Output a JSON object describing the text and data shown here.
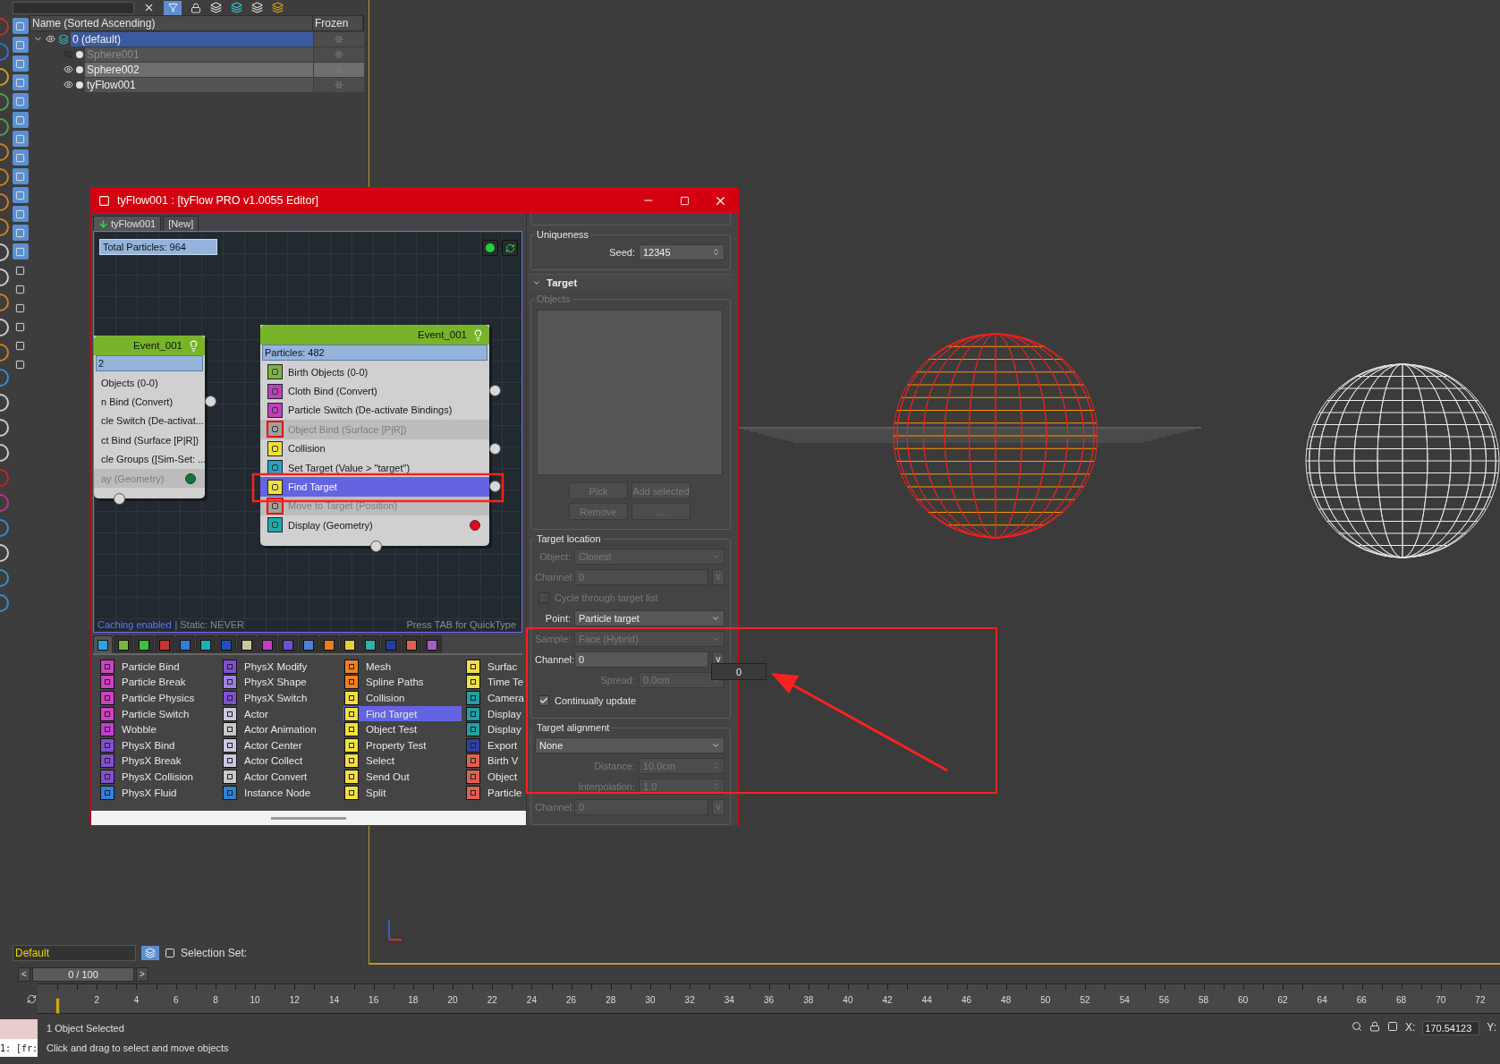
{
  "scene_explorer": {
    "columns": [
      "Name (Sorted Ascending)",
      "Frozen"
    ],
    "rows": [
      {
        "name": "0 (default)",
        "selected": true,
        "visible": true,
        "expanded": true,
        "children": [
          {
            "name": "Sphere001",
            "selected": false,
            "visible": false
          },
          {
            "name": "Sphere002",
            "selected": true,
            "visible": true
          },
          {
            "name": "tyFlow001",
            "selected": false,
            "visible": true
          }
        ]
      }
    ]
  },
  "editor": {
    "title": "tyFlow001 : [tyFlow PRO v1.0055 Editor]",
    "tabs": [
      {
        "label": "tyFlow001",
        "selected": true
      },
      {
        "label": "[New]",
        "selected": false
      }
    ],
    "total_particles": "Total Particles: 964",
    "nodes": [
      {
        "title": "Event_001",
        "particles": "2",
        "operators": [
          {
            "label": "Objects (0-0)",
            "enabled": true,
            "selected": false,
            "output": false
          },
          {
            "label": "n Bind (Convert)",
            "enabled": true,
            "selected": false,
            "output": true
          },
          {
            "label": "cle Switch (De-activat...",
            "enabled": true,
            "selected": false,
            "output": false
          },
          {
            "label": "ct Bind (Surface [P|R])",
            "enabled": true,
            "selected": false,
            "output": false
          },
          {
            "label": "cle Groups ([Sim-Set: ...",
            "enabled": true,
            "selected": false,
            "output": false
          },
          {
            "label": "ay (Geometry)",
            "enabled": false,
            "selected": false,
            "output": false,
            "status_dot": {
              "color": "#0a7a3a"
            }
          }
        ]
      },
      {
        "title": "Event_001",
        "particles": "Particles: 482",
        "operators": [
          {
            "label": "Birth Objects (0-0)",
            "enabled": true,
            "selected": false,
            "output": false,
            "color": "#7cb342"
          },
          {
            "label": "Cloth Bind (Convert)",
            "enabled": true,
            "selected": false,
            "output": true,
            "color": "#c040c0"
          },
          {
            "label": "Particle Switch (De-activate Bindings)",
            "enabled": true,
            "selected": false,
            "output": false,
            "color": "#c040c0"
          },
          {
            "label": "Object Bind (Surface [P|R])",
            "enabled": false,
            "selected": false,
            "output": false,
            "color": "#a0a0a0"
          },
          {
            "label": "Collision",
            "enabled": true,
            "selected": false,
            "output": true,
            "color": "#f0e040"
          },
          {
            "label": "Set Target (Value > \"target\")",
            "enabled": true,
            "selected": false,
            "output": false,
            "color": "#2aa0c8"
          },
          {
            "label": "Find Target",
            "enabled": true,
            "selected": true,
            "output": true,
            "color": "#f0e040"
          },
          {
            "label": "Move to Target (Position)",
            "enabled": false,
            "selected": false,
            "output": false,
            "color": "#a0a0a0"
          },
          {
            "label": "Display (Geometry)",
            "enabled": true,
            "selected": false,
            "output": false,
            "color": "#20a8a8",
            "status_dot": {
              "color": "#e8001c"
            }
          }
        ]
      }
    ],
    "footer": {
      "caching": "Caching enabled",
      "static": "| Static: NEVER",
      "hint": "Press TAB for QuickType"
    },
    "category_tabs": [
      {
        "color": "#30a0e0",
        "selected": true
      },
      {
        "color": "#7cb342",
        "selected": false
      },
      {
        "color": "#40c040",
        "selected": false
      },
      {
        "color": "#d03030",
        "selected": false
      },
      {
        "color": "#3080d0",
        "selected": false
      },
      {
        "color": "#20b0b0",
        "selected": false
      },
      {
        "color": "#2050c0",
        "selected": false
      },
      {
        "color": "#c8c8a0",
        "selected": false
      },
      {
        "color": "#c040c0",
        "selected": false
      },
      {
        "color": "#7050d0",
        "selected": false
      },
      {
        "color": "#5080d0",
        "selected": false
      },
      {
        "color": "#e08020",
        "selected": false
      },
      {
        "color": "#e0d040",
        "selected": false
      },
      {
        "color": "#30b0b0",
        "selected": false
      },
      {
        "color": "#2040a0",
        "selected": false
      },
      {
        "color": "#e06050",
        "selected": false
      },
      {
        "color": "#a060c0",
        "selected": false
      }
    ],
    "operator_columns": [
      [
        {
          "label": "Particle Bind",
          "color": "#d040c0",
          "selected": false
        },
        {
          "label": "Particle Break",
          "color": "#d040c0",
          "selected": false
        },
        {
          "label": "Particle Physics",
          "color": "#d040c0",
          "selected": false
        },
        {
          "label": "Particle Switch",
          "color": "#d040c0",
          "selected": false
        },
        {
          "label": "Wobble",
          "color": "#c040d0",
          "selected": false
        },
        {
          "label": "PhysX Bind",
          "color": "#8050d0",
          "selected": false
        },
        {
          "label": "PhysX Break",
          "color": "#8050d0",
          "selected": false
        },
        {
          "label": "PhysX Collision",
          "color": "#8050d0",
          "selected": false
        },
        {
          "label": "PhysX Fluid",
          "color": "#3080e0",
          "selected": false
        }
      ],
      [
        {
          "label": "PhysX Modify",
          "color": "#8050d0",
          "selected": false
        },
        {
          "label": "PhysX Shape",
          "color": "#a080e0",
          "selected": false
        },
        {
          "label": "PhysX Switch",
          "color": "#8050d0",
          "selected": false
        },
        {
          "label": "Actor",
          "color": "#c8c8e0",
          "selected": false
        },
        {
          "label": "Actor Animation",
          "color": "#c8c8c8",
          "selected": false
        },
        {
          "label": "Actor Center",
          "color": "#c8c8e0",
          "selected": false
        },
        {
          "label": "Actor Collect",
          "color": "#c8c8e0",
          "selected": false
        },
        {
          "label": "Actor Convert",
          "color": "#c8c8c8",
          "selected": false
        },
        {
          "label": "Instance Node",
          "color": "#3080d0",
          "selected": false
        }
      ],
      [
        {
          "label": "Mesh",
          "color": "#f08020",
          "selected": false
        },
        {
          "label": "Spline Paths",
          "color": "#f08020",
          "selected": false
        },
        {
          "label": "Collision",
          "color": "#f0e040",
          "selected": false
        },
        {
          "label": "Find Target",
          "color": "#f0e040",
          "selected": true
        },
        {
          "label": "Object Test",
          "color": "#f0e040",
          "selected": false
        },
        {
          "label": "Property Test",
          "color": "#f0e040",
          "selected": false
        },
        {
          "label": "Select",
          "color": "#f0e040",
          "selected": false
        },
        {
          "label": "Send Out",
          "color": "#f0e040",
          "selected": false
        },
        {
          "label": "Split",
          "color": "#f0e040",
          "selected": false
        }
      ],
      [
        {
          "label": "Surfac",
          "color": "#f0e040",
          "selected": false
        },
        {
          "label": "Time Te",
          "color": "#f0e040",
          "selected": false
        },
        {
          "label": "Camera",
          "color": "#20a0a0",
          "selected": false
        },
        {
          "label": "Display",
          "color": "#20a0a0",
          "selected": false
        },
        {
          "label": "Display",
          "color": "#20a0a0",
          "selected": false
        },
        {
          "label": "Export",
          "color": "#3040a0",
          "selected": false
        },
        {
          "label": "Birth V",
          "color": "#e06050",
          "selected": false
        },
        {
          "label": "Object",
          "color": "#e06050",
          "selected": false
        },
        {
          "label": "Particle",
          "color": "#e06050",
          "selected": false
        }
      ]
    ]
  },
  "panel": {
    "uniqueness": {
      "title": "Uniqueness",
      "seed_label": "Seed:",
      "seed": "12345"
    },
    "rollout": {
      "title": "Target",
      "expanded": true
    },
    "objects": {
      "title": "Objects",
      "enabled": false,
      "buttons": [
        {
          "label": "Pick",
          "enabled": false
        },
        {
          "label": "Add selected",
          "enabled": false
        },
        {
          "label": "Remove",
          "enabled": false
        },
        {
          "label": "...",
          "enabled": false
        }
      ]
    },
    "groups": [
      {
        "title": "Target location",
        "controls": [
          {
            "kind": "dropdown",
            "label": "Object:",
            "value": "Closest",
            "enabled": false
          },
          {
            "kind": "channel",
            "label": "Channel:",
            "value": "0",
            "button": "v",
            "enabled": false
          },
          {
            "kind": "checkbox",
            "label": "Cycle through target list",
            "checked": false,
            "enabled": false
          },
          {
            "kind": "dropdown",
            "label": "Point:",
            "value": "Particle target",
            "enabled": true
          },
          {
            "kind": "dropdown",
            "label": "Sample:",
            "value": "Face (Hybrid)",
            "enabled": false
          },
          {
            "kind": "channel",
            "label": "Channel:",
            "value": "0",
            "button": "v",
            "enabled": true
          },
          {
            "kind": "spinner",
            "label": "Spread:",
            "value": "0.0cm",
            "enabled": false
          },
          {
            "kind": "checkbox",
            "label": "Continually update",
            "checked": true,
            "enabled": true
          }
        ]
      },
      {
        "title": "Target alignment",
        "controls": [
          {
            "kind": "dropdown",
            "value": "None",
            "enabled": true
          },
          {
            "kind": "spinner",
            "label": "Distance:",
            "value": "10.0cm",
            "enabled": false
          },
          {
            "kind": "spinner",
            "label": "Interpolation:",
            "value": "1.0",
            "enabled": false
          },
          {
            "kind": "channel",
            "label": "Channel:",
            "value": "0",
            "button": "v",
            "enabled": false
          }
        ]
      }
    ],
    "popup": {
      "value": "0"
    }
  },
  "layer_bar": {
    "layer": "Default",
    "selection_set_label": "Selection Set:"
  },
  "time_slider": {
    "prev": "<",
    "position": "0 / 100",
    "next": ">",
    "level": 0
  },
  "timeline": {
    "ticks": [
      "2",
      "4",
      "6",
      "8",
      "10",
      "12",
      "14",
      "16",
      "18",
      "20",
      "22",
      "24",
      "26",
      "28",
      "30",
      "32",
      "34",
      "36",
      "38",
      "40",
      "42",
      "44",
      "46",
      "48",
      "50",
      "52",
      "54",
      "56",
      "58",
      "60",
      "62",
      "64",
      "66",
      "68",
      "70",
      "72"
    ]
  },
  "status_bar": {
    "listener": "1: [fr:",
    "selection": "1 Object Selected",
    "prompt": "Click and drag to select and move objects",
    "x_label": "X:",
    "x_value": "170.54123",
    "y_label": "Y:"
  }
}
